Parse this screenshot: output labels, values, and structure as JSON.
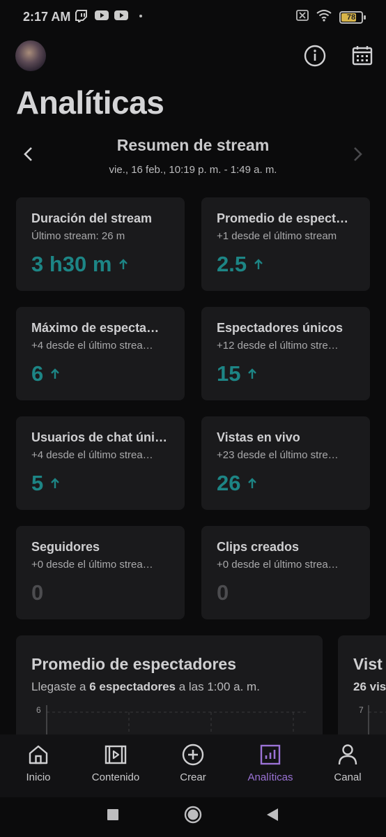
{
  "status_bar": {
    "time": "2:17 AM",
    "left_icons": [
      "twitch-icon",
      "youtube-icon",
      "youtube-icon"
    ],
    "battery_level": "78",
    "battery_color": "#d7b44a"
  },
  "header": {
    "title": "Analíticas",
    "info_icon": "info-icon",
    "calendar_icon": "calendar-icon"
  },
  "summary": {
    "title": "Resumen de stream",
    "date_range": "vie., 16 feb., 10:19 p. m. - 1:49 a. m."
  },
  "cards": [
    {
      "title": "Duración del stream",
      "subtitle": "Último stream: 26 m",
      "value": "3 h30 m",
      "trend": "up"
    },
    {
      "title": "Promedio de espect…",
      "subtitle": "+1 desde el último stream",
      "value": "2.5",
      "trend": "up"
    },
    {
      "title": "Máximo de especta…",
      "subtitle": "+4 desde el último strea…",
      "value": "6",
      "trend": "up"
    },
    {
      "title": "Espectadores únicos",
      "subtitle": "+12 desde el último stre…",
      "value": "15",
      "trend": "up"
    },
    {
      "title": "Usuarios de chat úni…",
      "subtitle": "+4 desde el último strea…",
      "value": "5",
      "trend": "up"
    },
    {
      "title": "Vistas en vivo",
      "subtitle": "+23 desde el último stre…",
      "value": "26",
      "trend": "up"
    },
    {
      "title": "Seguidores",
      "subtitle": "+0 desde el último strea…",
      "value": "0",
      "trend": "none"
    },
    {
      "title": "Clips creados",
      "subtitle": "+0 desde el último strea…",
      "value": "0",
      "trend": "none"
    }
  ],
  "chart_cards": [
    {
      "title": "Promedio de espectadores",
      "subtitle_pre": "Llegaste a ",
      "subtitle_bold": "6 espectadores",
      "subtitle_post": " a las 1:00 a. m.",
      "y_top": "6"
    },
    {
      "title": "Vist",
      "subtitle_pre": "",
      "subtitle_bold": "26 vis",
      "subtitle_post": "",
      "y_top": "7"
    }
  ],
  "bottom_nav": [
    {
      "label": "Inicio",
      "icon": "home-icon",
      "active": false
    },
    {
      "label": "Contenido",
      "icon": "content-icon",
      "active": false
    },
    {
      "label": "Crear",
      "icon": "plus-circle-icon",
      "active": false
    },
    {
      "label": "Analíticas",
      "icon": "analytics-icon",
      "active": true
    },
    {
      "label": "Canal",
      "icon": "person-icon",
      "active": false
    }
  ],
  "colors": {
    "accent_teal": "#1d8585",
    "accent_purple": "#9b73d6"
  }
}
